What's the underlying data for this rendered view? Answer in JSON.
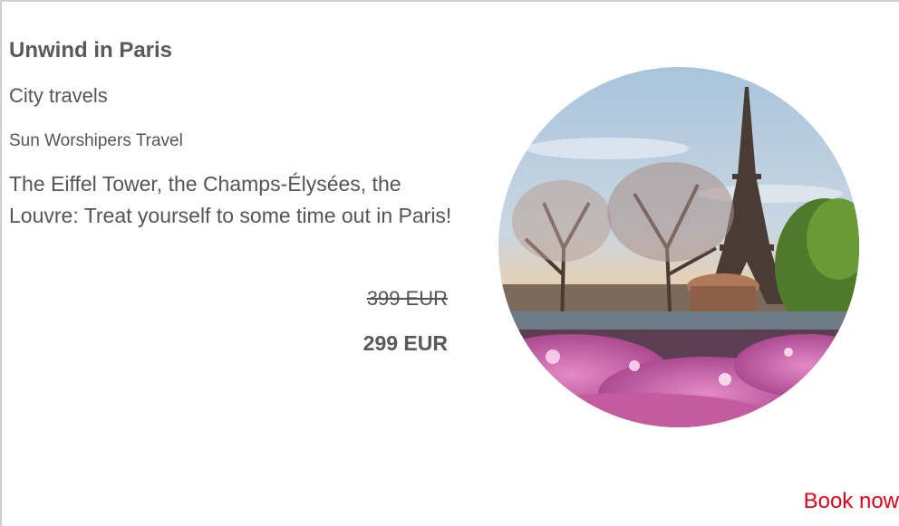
{
  "offer": {
    "title": "Unwind in Paris",
    "category": "City travels",
    "provider": "Sun Worshipers Travel",
    "description": "The Eiffel Tower, the Champs-Élysées, the Louvre: Treat yourself to some time out in Paris!",
    "price_old": "399 EUR",
    "price_new": "299 EUR",
    "book_label": "Book now"
  },
  "colors": {
    "text": "#555555",
    "accent": "#e2001a",
    "border": "#cfcfcf"
  }
}
